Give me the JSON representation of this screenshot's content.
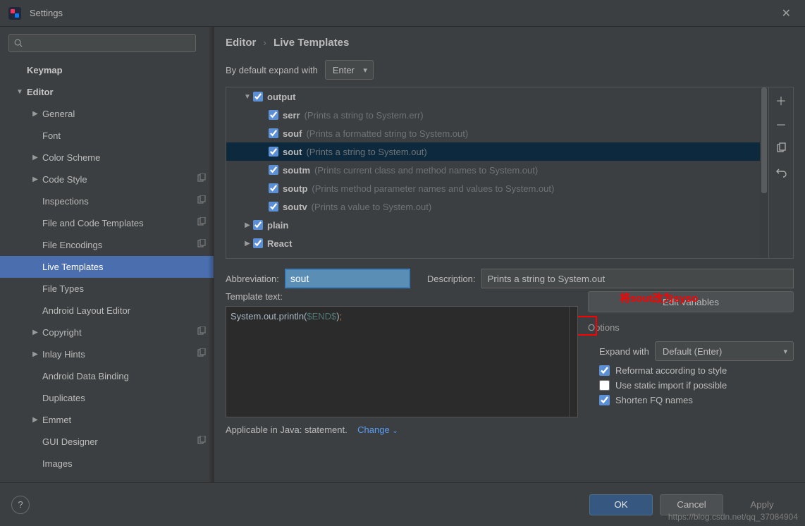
{
  "window": {
    "title": "Settings"
  },
  "breadcrumb": {
    "root": "Editor",
    "leaf": "Live Templates"
  },
  "expand": {
    "label": "By default expand with",
    "value": "Enter"
  },
  "sidebar": {
    "items": [
      {
        "label": "Keymap",
        "depth": 0,
        "arrow": "",
        "bold": true
      },
      {
        "label": "Editor",
        "depth": 0,
        "arrow": "▼",
        "bold": true
      },
      {
        "label": "General",
        "depth": 1,
        "arrow": "▶"
      },
      {
        "label": "Font",
        "depth": 1,
        "arrow": ""
      },
      {
        "label": "Color Scheme",
        "depth": 1,
        "arrow": "▶"
      },
      {
        "label": "Code Style",
        "depth": 1,
        "arrow": "▶",
        "cfg": true
      },
      {
        "label": "Inspections",
        "depth": 1,
        "arrow": "",
        "cfg": true
      },
      {
        "label": "File and Code Templates",
        "depth": 1,
        "arrow": "",
        "cfg": true
      },
      {
        "label": "File Encodings",
        "depth": 1,
        "arrow": "",
        "cfg": true
      },
      {
        "label": "Live Templates",
        "depth": 1,
        "arrow": "",
        "selected": true
      },
      {
        "label": "File Types",
        "depth": 1,
        "arrow": ""
      },
      {
        "label": "Android Layout Editor",
        "depth": 1,
        "arrow": ""
      },
      {
        "label": "Copyright",
        "depth": 1,
        "arrow": "▶",
        "cfg": true
      },
      {
        "label": "Inlay Hints",
        "depth": 1,
        "arrow": "▶",
        "cfg": true
      },
      {
        "label": "Android Data Binding",
        "depth": 1,
        "arrow": ""
      },
      {
        "label": "Duplicates",
        "depth": 1,
        "arrow": ""
      },
      {
        "label": "Emmet",
        "depth": 1,
        "arrow": "▶"
      },
      {
        "label": "GUI Designer",
        "depth": 1,
        "arrow": "",
        "cfg": true
      },
      {
        "label": "Images",
        "depth": 1,
        "arrow": ""
      }
    ]
  },
  "templates": {
    "rows": [
      {
        "arr": "▼",
        "depth": 1,
        "name": "output",
        "desc": "",
        "checked": true
      },
      {
        "arr": "",
        "depth": 2,
        "name": "serr",
        "desc": "(Prints a string to System.err)",
        "checked": true
      },
      {
        "arr": "",
        "depth": 2,
        "name": "souf",
        "desc": "(Prints a formatted string to System.out)",
        "checked": true
      },
      {
        "arr": "",
        "depth": 2,
        "name": "sout",
        "desc": "(Prints a string to System.out)",
        "checked": true,
        "selected": true
      },
      {
        "arr": "",
        "depth": 2,
        "name": "soutm",
        "desc": "(Prints current class and method names to System.out)",
        "checked": true
      },
      {
        "arr": "",
        "depth": 2,
        "name": "soutp",
        "desc": "(Prints method parameter names and values to System.out)",
        "checked": true
      },
      {
        "arr": "",
        "depth": 2,
        "name": "soutv",
        "desc": "(Prints a value to System.out)",
        "checked": true
      },
      {
        "arr": "▶",
        "depth": 1,
        "name": "plain",
        "desc": "",
        "checked": true
      },
      {
        "arr": "▶",
        "depth": 1,
        "name": "React",
        "desc": "",
        "checked": true
      }
    ]
  },
  "annotation": {
    "text": "将sout改为syso"
  },
  "form": {
    "abbr_label": "Abbreviation:",
    "abbr_value": "sout",
    "desc_label": "Description:",
    "desc_value": "Prints a string to System.out",
    "tmpl_label": "Template text:",
    "tmpl_code": {
      "prefix": "System.out.println(",
      "var": "$END$",
      "suffix": ");"
    },
    "edit_vars": "Edit variables"
  },
  "options": {
    "title": "Options",
    "expand_label": "Expand with",
    "expand_value": "Default (Enter)",
    "items": [
      {
        "label": "Reformat according to style",
        "checked": true
      },
      {
        "label": "Use static import if possible",
        "checked": false
      },
      {
        "label": "Shorten FQ names",
        "checked": true
      }
    ]
  },
  "applicable": {
    "text": "Applicable in Java: statement.",
    "link": "Change"
  },
  "footer": {
    "ok": "OK",
    "cancel": "Cancel",
    "apply": "Apply"
  },
  "watermark": "https://blog.csdn.net/qq_37084904"
}
